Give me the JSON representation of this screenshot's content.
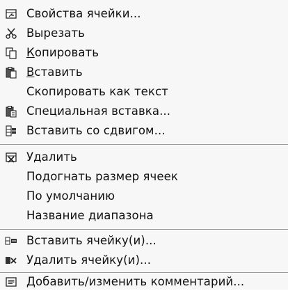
{
  "menu": {
    "items": [
      {
        "label": "Свойства ячейки...",
        "icon": "cell-properties-icon"
      },
      {
        "label": "Вырезать",
        "icon": "scissors-icon"
      },
      {
        "label": "Копировать",
        "icon": "copy-icon"
      },
      {
        "label": "Вставить",
        "icon": "paste-icon"
      },
      {
        "label": "Скопировать как текст",
        "icon": ""
      },
      {
        "label": "Специальная вставка...",
        "icon": "paste-special-icon"
      },
      {
        "label": "Вставить со сдвигом...",
        "icon": "insert-shift-icon"
      },
      {
        "label": "Удалить",
        "icon": "delete-icon"
      },
      {
        "label": "Подогнать размер ячеек",
        "icon": ""
      },
      {
        "label": "По умолчанию",
        "icon": ""
      },
      {
        "label": "Название диапазона",
        "icon": ""
      },
      {
        "label": "Вставить ячейку(и)...",
        "icon": "insert-cells-icon"
      },
      {
        "label": "Удалить ячейку(и)...",
        "icon": "delete-cells-icon"
      },
      {
        "label": "Добавить/изменить комментарий...",
        "icon": "comment-icon"
      }
    ]
  },
  "colors": {
    "background": "#f7f7f7",
    "text": "#111111",
    "separator": "#9a9a9a"
  }
}
